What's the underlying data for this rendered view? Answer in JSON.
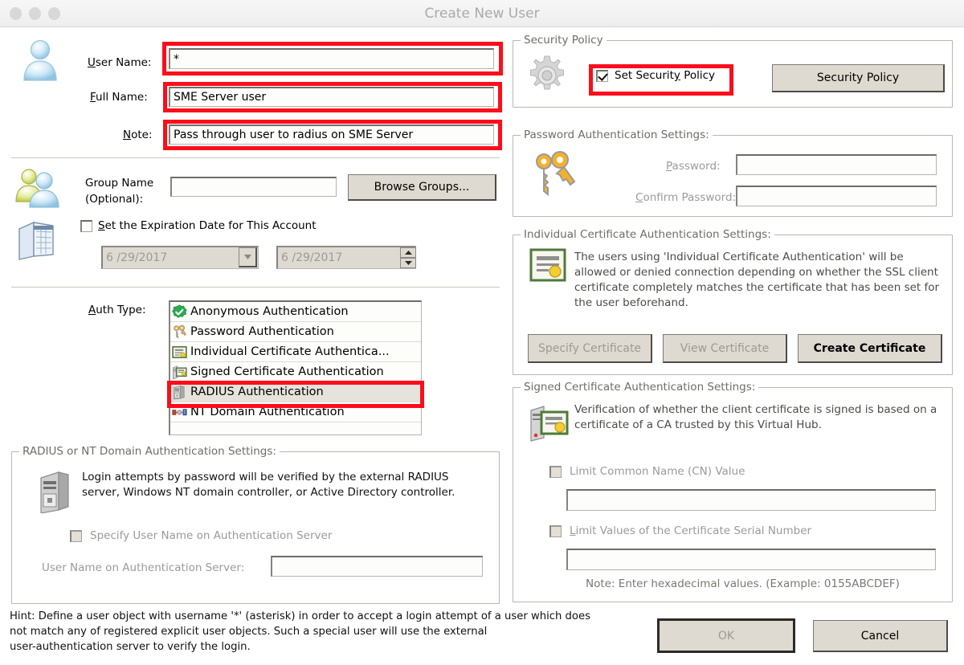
{
  "window": {
    "title": "Create New User",
    "traffic_lights": [
      "close-dot",
      "minimize-dot",
      "zoom-dot"
    ]
  },
  "left": {
    "user_name_label": "User Name:",
    "user_name_value": "*",
    "full_name_label": "Full Name:",
    "full_name_value": "SME Server user",
    "note_label": "Note:",
    "note_value": "Pass through user to radius on SME Server",
    "group_name_label_line1": "Group Name",
    "group_name_label_line2": "(Optional):",
    "group_name_value": "",
    "browse_groups_button": "Browse Groups...",
    "expiration_checkbox_label": "Set the Expiration Date for This Account",
    "expiration_checked": false,
    "expiration_date_1": "6 /29/2017",
    "expiration_date_2": "6 /29/2017",
    "auth_type_label": "Auth Type:",
    "auth_types": [
      {
        "label": "Anonymous Authentication",
        "icon": "green-check-icon",
        "selected": false
      },
      {
        "label": "Password Authentication",
        "icon": "keys-icon",
        "selected": false
      },
      {
        "label": "Individual Certificate Authentica...",
        "icon": "certificate-icon",
        "selected": false
      },
      {
        "label": "Signed Certificate Authentication",
        "icon": "signed-certificate-icon",
        "selected": false
      },
      {
        "label": "RADIUS Authentication",
        "icon": "server-icon",
        "selected": true
      },
      {
        "label": "NT Domain Authentication",
        "icon": "nt-domain-icon",
        "selected": false
      }
    ],
    "radius_group_caption": "RADIUS or NT Domain Authentication Settings:",
    "radius_description": "Login attempts by password will be verified by the external RADIUS server, Windows NT domain controller, or Active Directory controller.",
    "specify_user_name_checkbox": "Specify User Name on Authentication Server",
    "specify_user_name_checked": false,
    "user_name_on_auth_server_label": "User Name on Authentication Server:",
    "user_name_on_auth_server_value": ""
  },
  "right": {
    "security_policy_caption": "Security Policy",
    "set_security_policy_label": "Set Security Policy",
    "set_security_policy_checked": true,
    "security_policy_button": "Security Policy",
    "password_group_caption": "Password Authentication Settings:",
    "password_label": "Password:",
    "password_value": "",
    "confirm_password_label": "Confirm Password:",
    "confirm_password_value": "",
    "individual_cert_caption": "Individual Certificate Authentication Settings:",
    "individual_cert_description": "The users using 'Individual Certificate Authentication' will be allowed or denied connection depending on whether the SSL client certificate completely matches the certificate that has been set for the user beforehand.",
    "specify_certificate_button": "Specify Certificate",
    "view_certificate_button": "View Certificate",
    "create_certificate_button": "Create Certificate",
    "signed_cert_caption": "Signed Certificate Authentication Settings:",
    "signed_cert_description": "Verification of whether the client certificate is signed is based on a certificate of a CA trusted by this Virtual Hub.",
    "limit_cn_label": "Limit Common Name (CN) Value",
    "limit_cn_checked": false,
    "limit_cn_value": "",
    "limit_serial_label": "Limit Values of the Certificate Serial Number",
    "limit_serial_checked": false,
    "limit_serial_value": "",
    "hex_note": "Note: Enter hexadecimal values. (Example: 0155ABCDEF)"
  },
  "footer": {
    "hint_line1": "Hint: Define a user object with username '*' (asterisk) in order to accept a login attempt of a user which does",
    "hint_line2": "not match any of registered explicit user objects. Such a special user will use the external",
    "hint_line3": "user-authentication server to verify the login.",
    "ok_button": "OK",
    "cancel_button": "Cancel"
  },
  "annotations": {
    "color": "#fc0d1b",
    "highlighted": [
      "user-name-field",
      "full-name-field",
      "note-field",
      "radius-auth-list-item",
      "set-security-policy-checkbox"
    ]
  }
}
